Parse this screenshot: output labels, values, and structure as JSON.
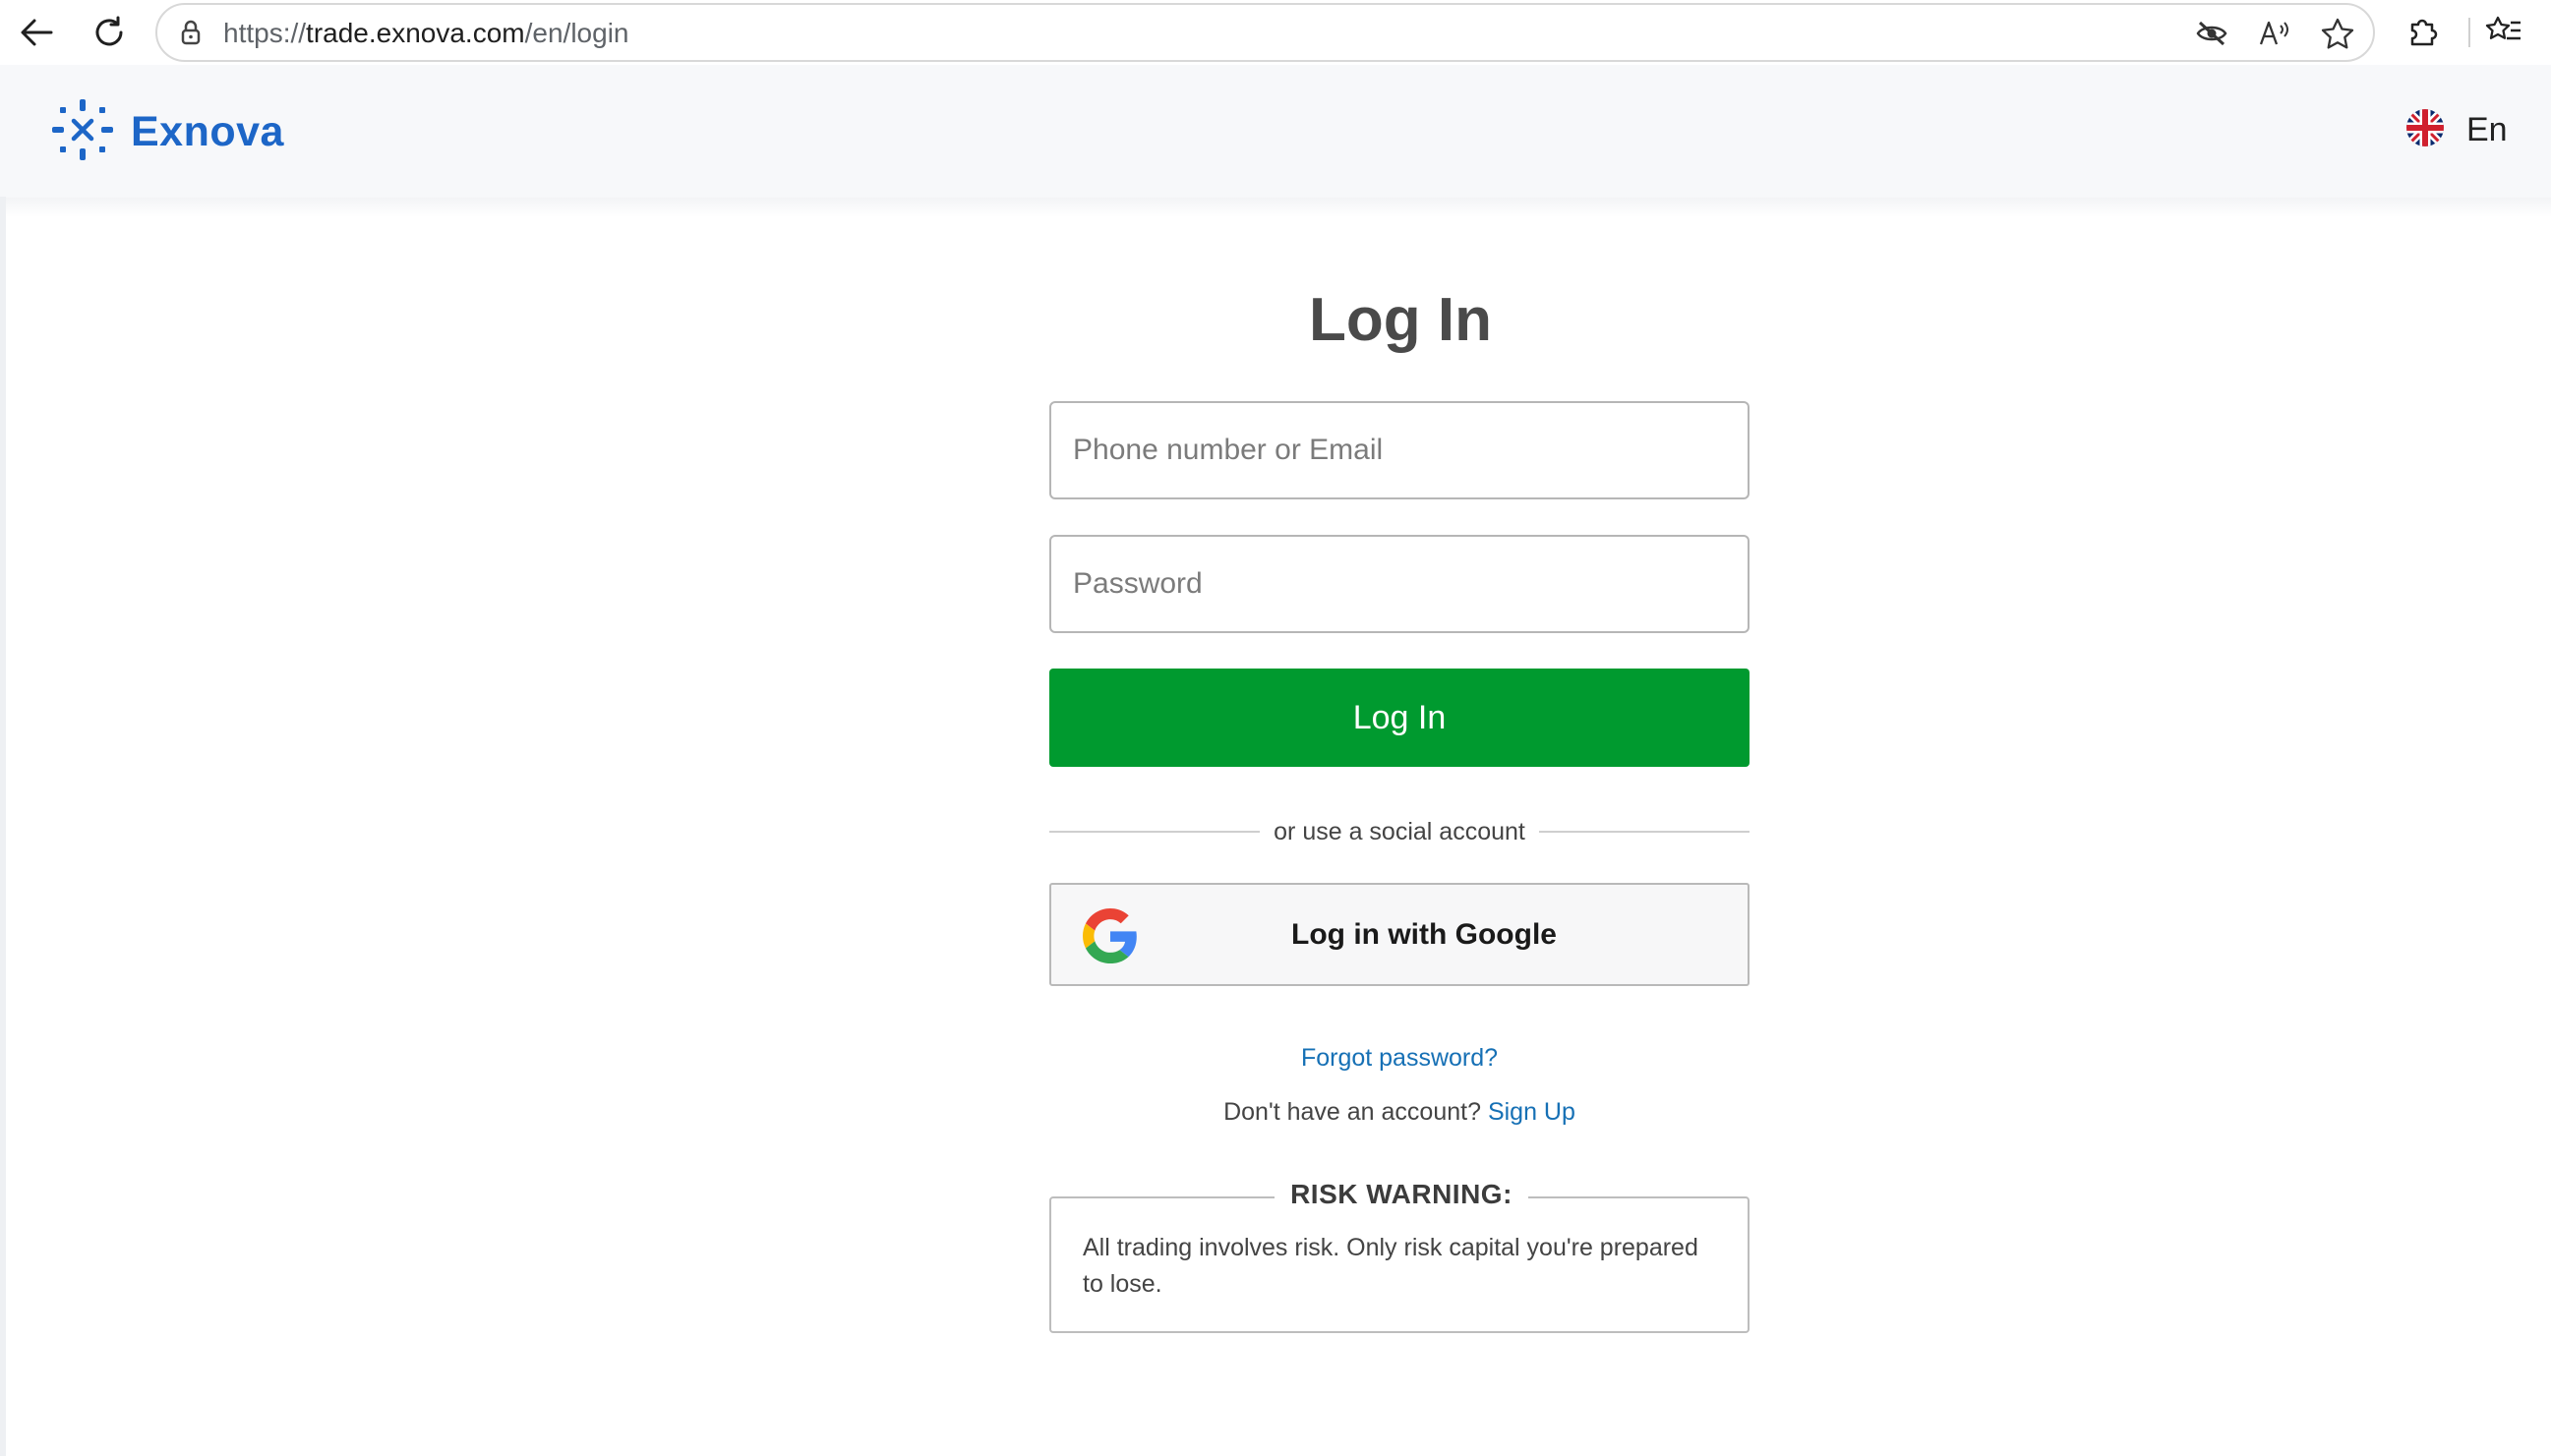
{
  "browser": {
    "url_scheme": "https://",
    "url_host": "trade.exnova.com",
    "url_path": "/en/login"
  },
  "header": {
    "logo_text": "Exnova",
    "language": "En"
  },
  "login": {
    "title": "Log In",
    "email_placeholder": "Phone number or Email",
    "password_placeholder": "Password",
    "login_button": "Log In",
    "divider_text": "or use a social account",
    "google_button": "Log in with Google",
    "forgot_password": "Forgot password?",
    "no_account_text": "Don't have an account?",
    "signup_link": "Sign Up"
  },
  "risk": {
    "title": "RISK WARNING:",
    "text": "All trading involves risk. Only risk capital you're prepared to lose."
  },
  "colors": {
    "brand_blue": "#1d66c7",
    "login_green": "#009a2f",
    "link_blue": "#1670b5"
  },
  "icons": [
    "back-arrow-icon",
    "refresh-icon",
    "lock-icon",
    "tracking-hidden-icon",
    "read-aloud-icon",
    "favorite-star-icon",
    "extensions-icon",
    "favorites-list-icon",
    "exnova-logo-icon",
    "uk-flag-icon",
    "google-g-icon"
  ]
}
